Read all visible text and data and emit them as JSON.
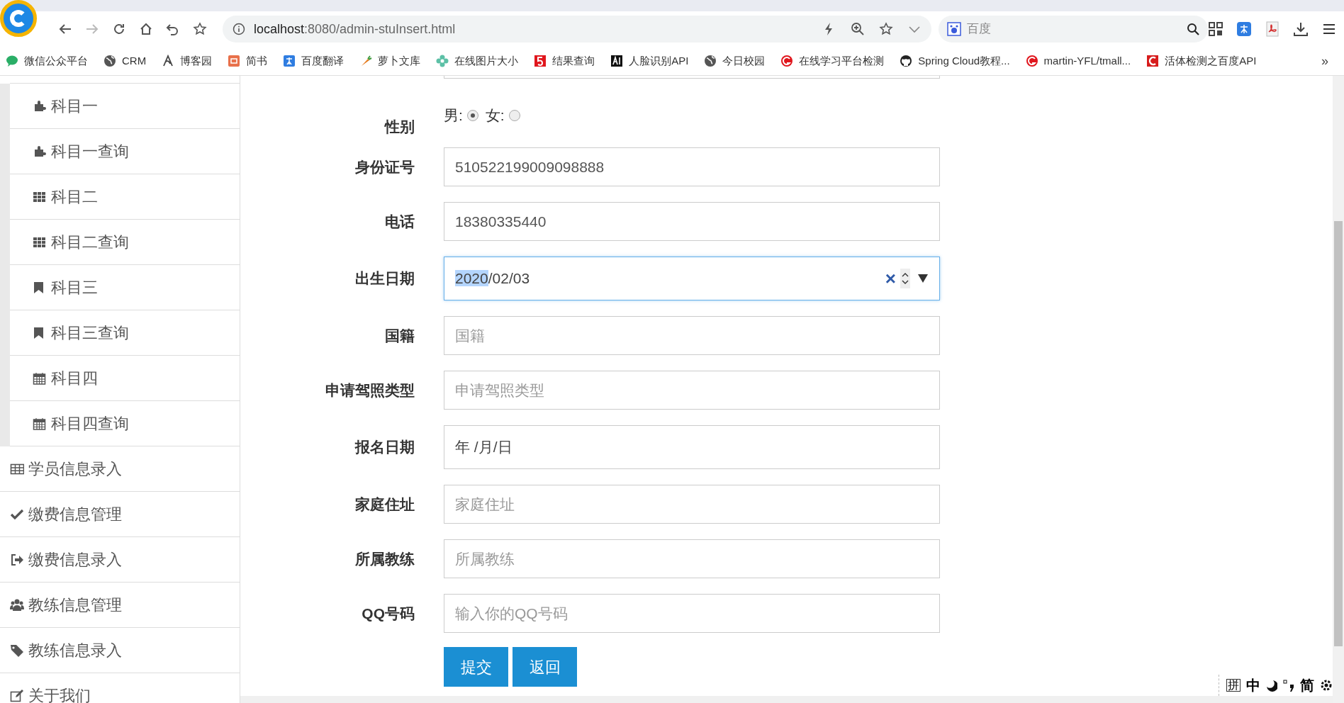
{
  "browser": {
    "address": {
      "host": "localhost",
      "rest": ":8080/admin-stuInsert.html"
    },
    "search_placeholder": "百度",
    "bookmarks": [
      {
        "label": "微信公众平台"
      },
      {
        "label": "CRM"
      },
      {
        "label": "博客园"
      },
      {
        "label": "简书"
      },
      {
        "label": "百度翻译"
      },
      {
        "label": "萝卜文库"
      },
      {
        "label": "在线图片大小"
      },
      {
        "label": "结果查询"
      },
      {
        "label": "人脸识别API"
      },
      {
        "label": "今日校园"
      },
      {
        "label": "在线学习平台检测"
      },
      {
        "label": "Spring Cloud教程..."
      },
      {
        "label": "martin-YFL/tmall..."
      },
      {
        "label": "活体检测之百度API"
      }
    ],
    "more": "»"
  },
  "sidebar": {
    "items": [
      {
        "label": "科目一",
        "sub": true
      },
      {
        "label": "科目一查询",
        "sub": true
      },
      {
        "label": "科目二",
        "sub": true
      },
      {
        "label": "科目二查询",
        "sub": true
      },
      {
        "label": "科目三",
        "sub": true
      },
      {
        "label": "科目三查询",
        "sub": true
      },
      {
        "label": "科目四",
        "sub": true
      },
      {
        "label": "科目四查询",
        "sub": true
      },
      {
        "label": "学员信息录入",
        "sub": false
      },
      {
        "label": "缴费信息管理",
        "sub": false
      },
      {
        "label": "缴费信息录入",
        "sub": false
      },
      {
        "label": "教练信息管理",
        "sub": false
      },
      {
        "label": "教练信息录入",
        "sub": false
      },
      {
        "label": "关于我们",
        "sub": false
      }
    ]
  },
  "form": {
    "fields": [
      {
        "kind": "radio",
        "label": "性别",
        "options": [
          {
            "label": "男:",
            "selected": true
          },
          {
            "label": "女:",
            "selected": false
          }
        ]
      },
      {
        "kind": "text",
        "label": "身份证号",
        "value": "510522199009098888"
      },
      {
        "kind": "text",
        "label": "电话",
        "value": "18380335440"
      },
      {
        "kind": "date",
        "label": "出生日期",
        "focused": true,
        "parts": [
          {
            "text": "2020",
            "selected": true
          },
          {
            "text": "/02/03",
            "selected": false
          }
        ],
        "clear": "×"
      },
      {
        "kind": "text",
        "label": "国籍",
        "placeholder": "国籍"
      },
      {
        "kind": "text",
        "label": "申请驾照类型",
        "placeholder": "申请驾照类型"
      },
      {
        "kind": "date",
        "label": "报名日期",
        "focused": false,
        "parts": [
          {
            "text": "年 /月/日",
            "selected": false
          }
        ]
      },
      {
        "kind": "text",
        "label": "家庭住址",
        "placeholder": "家庭住址"
      },
      {
        "kind": "text",
        "label": "所属教练",
        "placeholder": "所属教练"
      },
      {
        "kind": "text",
        "label": "QQ号码",
        "placeholder": "输入你的QQ号码"
      }
    ],
    "buttons": [
      "提交",
      "返回"
    ]
  },
  "ime": [
    "拼",
    "中",
    "简"
  ]
}
